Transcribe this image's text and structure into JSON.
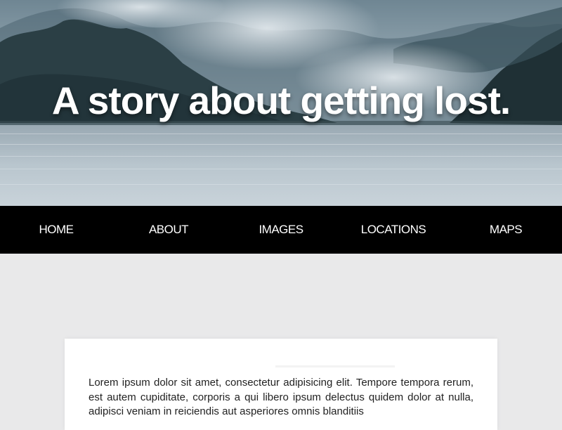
{
  "hero": {
    "title": "A story about getting lost."
  },
  "nav": {
    "items": [
      {
        "label": "HOME"
      },
      {
        "label": "ABOUT"
      },
      {
        "label": "IMAGES"
      },
      {
        "label": "LOCATIONS"
      },
      {
        "label": "MAPS"
      }
    ]
  },
  "article": {
    "body": "Lorem ipsum dolor sit amet, consectetur adipisicing elit. Tempore tempora rerum, est autem cupiditate, corporis a qui libero ipsum delectus quidem dolor at nulla, adipisci veniam in reiciendis aut asperiores omnis blanditiis"
  },
  "colors": {
    "nav_background": "#000000",
    "nav_text": "#ffffff",
    "page_background": "#e9e9ea",
    "card_background": "#ffffff"
  }
}
